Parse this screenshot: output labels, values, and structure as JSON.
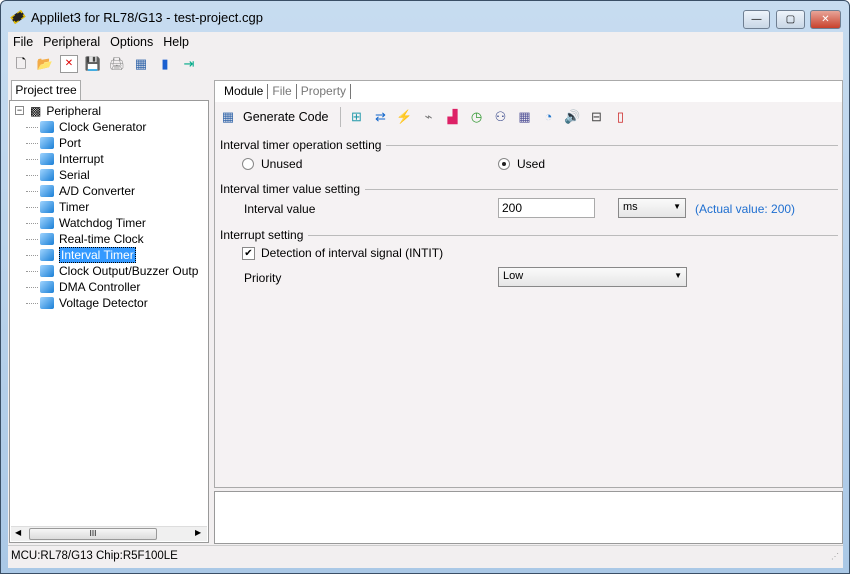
{
  "window": {
    "title": "Applilet3 for RL78/G13 - test-project.cgp",
    "minimize": "—",
    "maximize": "▢",
    "close": "✕"
  },
  "menu": [
    "File",
    "Peripheral",
    "Options",
    "Help"
  ],
  "toolbar": [
    "new-file-icon",
    "open-folder-icon",
    "close-project-icon",
    "save-icon",
    "save-as-icon",
    "generate-code-icon",
    "manual-icon",
    "exit-icon"
  ],
  "left": {
    "tab": "Project tree",
    "root": "Peripheral",
    "items": [
      "Clock Generator",
      "Port",
      "Interrupt",
      "Serial",
      "A/D Converter",
      "Timer",
      "Watchdog Timer",
      "Real-time Clock",
      "Interval Timer",
      "Clock Output/Buzzer Outp",
      "DMA Controller",
      "Voltage Detector"
    ],
    "selected": "Interval Timer",
    "scroll_thumb": "III"
  },
  "right": {
    "tabs": [
      "Module",
      "File",
      "Property"
    ],
    "generate_code": "Generate Code",
    "sections": {
      "op": "Interval timer operation setting",
      "value": "Interval timer value setting",
      "interrupt": "Interrupt setting"
    },
    "unused": "Unused",
    "used": "Used",
    "used_selected": true,
    "interval_label": "Interval value",
    "interval_value": "200",
    "unit": "ms",
    "actual": "(Actual value: 200)",
    "detect_label": "Detection of interval signal (INTIT)",
    "detect_checked": true,
    "priority_label": "Priority",
    "priority": "Low"
  },
  "status": {
    "text": "MCU:RL78/G13  Chip:R5F100LE"
  },
  "colors": {
    "selection": "#3399ff",
    "actual_value": "#1f6fd0"
  }
}
